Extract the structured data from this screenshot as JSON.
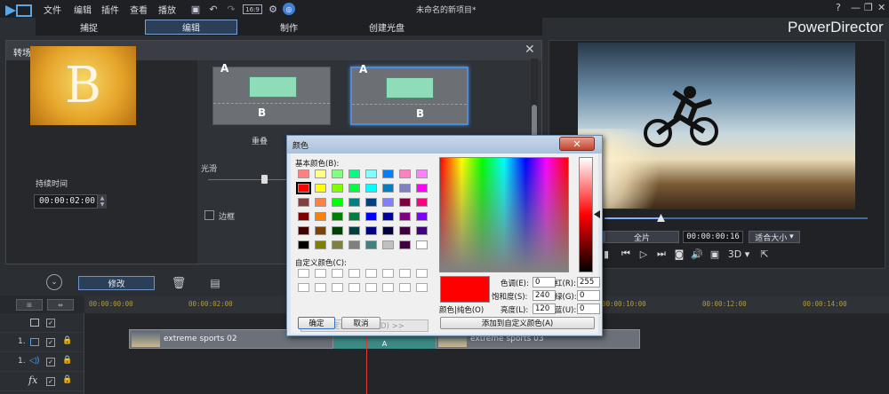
{
  "app": {
    "menu": [
      "文件",
      "编辑",
      "插件",
      "查看",
      "播放"
    ],
    "project_title": "未命名的新项目*",
    "brand": "PowerDirector",
    "help": "?",
    "minimize": "—",
    "restore": "❐",
    "close": "✕",
    "toolbar_icons": [
      "save-icon",
      "undo-icon",
      "redo-icon",
      "aspect-ratio-icon",
      "settings-icon",
      "cyberlink-icon"
    ],
    "aspect_label": "16:9"
  },
  "tabs": [
    "捕捉",
    "编辑",
    "制作",
    "创建光盘"
  ],
  "transition_panel": {
    "title": "转场设置",
    "close": "✕",
    "preview_letter": "B",
    "duration_label": "持续时间",
    "duration_value": "00:00:02:00",
    "thumb_caption": "重叠",
    "smooth_label": "光滑",
    "border_label": "边框",
    "letter_a": "A",
    "letter_b": "B"
  },
  "modify_bar": {
    "modify_label": "修改"
  },
  "player": {
    "full_label": "全片",
    "timecode": "00:00:00:16",
    "fit_label": "适合大小",
    "three_d_label": "3D",
    "progress": 0.21
  },
  "timeline": {
    "ticks": [
      "00:00:00:00",
      "00:00:02:00",
      "00:00:10:00",
      "00:00:12:00",
      "00:00:14:00"
    ],
    "tracks": [
      {
        "num": "",
        "type": "video"
      },
      {
        "num": "1.",
        "type": "video"
      },
      {
        "num": "1.",
        "type": "audio"
      },
      {
        "num": "",
        "type": "fx"
      }
    ],
    "clip1": "extreme sports 02",
    "clip2": "extreme sports 03",
    "fx_label": "fx"
  },
  "color_dialog": {
    "title": "颜色",
    "close": "✕",
    "basic_label": "基本颜色(B):",
    "custom_label": "自定义颜色(C):",
    "define_button": "规定自定义颜色(D) >>",
    "ok": "确定",
    "cancel": "取消",
    "solid_label": "颜色|纯色(O)",
    "add_button": "添加到自定义颜色(A)",
    "hue_label": "色调(E):",
    "hue": "0",
    "sat_label": "饱和度(S):",
    "sat": "240",
    "lum_label": "亮度(L):",
    "lum": "120",
    "red_label": "红(R):",
    "red": "255",
    "green_label": "绿(G):",
    "green": "0",
    "blue_label": "蓝(U):",
    "blue": "0",
    "basic_colors": [
      [
        "#ff8080",
        "#ffff80",
        "#80ff80",
        "#00ff80",
        "#80ffff",
        "#0080ff",
        "#ff80c0",
        "#ff80ff"
      ],
      [
        "#ff0000",
        "#ffff00",
        "#80ff00",
        "#00ff40",
        "#00ffff",
        "#0080c0",
        "#8080c0",
        "#ff00ff"
      ],
      [
        "#804040",
        "#ff8040",
        "#00ff00",
        "#008080",
        "#004080",
        "#8080ff",
        "#800040",
        "#ff0080"
      ],
      [
        "#800000",
        "#ff8000",
        "#008000",
        "#008040",
        "#0000ff",
        "#0000a0",
        "#800080",
        "#8000ff"
      ],
      [
        "#400000",
        "#804000",
        "#004000",
        "#004040",
        "#000080",
        "#000040",
        "#400040",
        "#400080"
      ],
      [
        "#000000",
        "#808000",
        "#808040",
        "#808080",
        "#408080",
        "#c0c0c0",
        "#400040",
        "#ffffff"
      ]
    ],
    "selected": "#ff0000"
  }
}
